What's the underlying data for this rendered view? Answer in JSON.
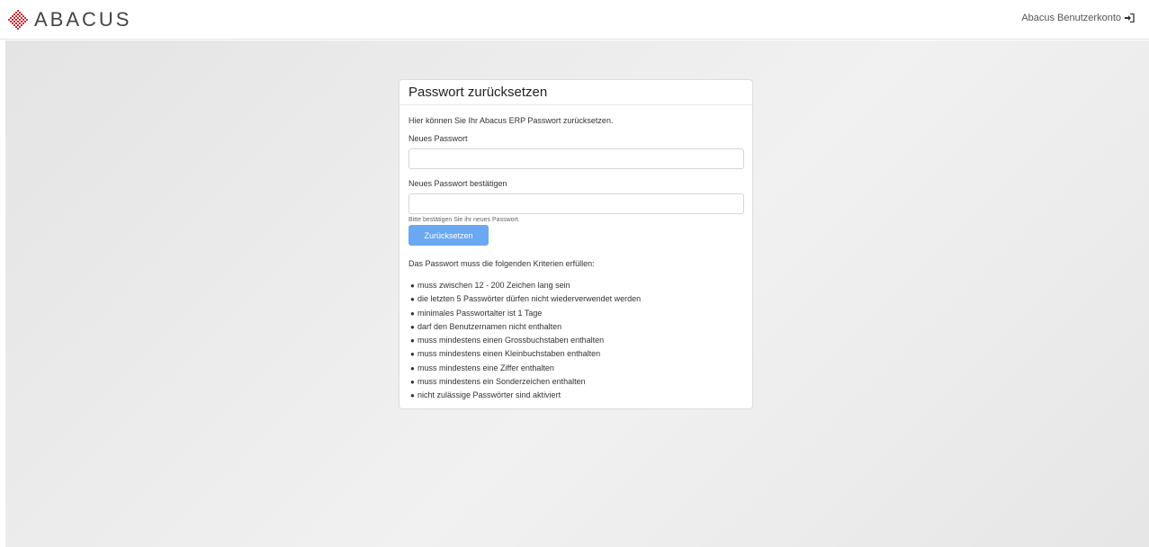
{
  "header": {
    "logo_text": "ABACUS",
    "account_link": "Abacus Benutzerkonto",
    "account_icon": "sign-in-icon"
  },
  "colors": {
    "brand_red": "#d7282f",
    "button": "#6aa9f2",
    "background": "#ebebeb"
  },
  "card": {
    "title": "Passwort zurücksetzen",
    "intro": "Hier können Sie Ihr Abacus ERP Passwort zurücksetzen.",
    "new_password_label": "Neues Passwort",
    "new_password_value": "",
    "confirm_password_label": "Neues Passwort bestätigen",
    "confirm_password_value": "",
    "confirm_hint": "Bitte bestätigen Sie ihr neues Passwort.",
    "submit_label": "Zurücksetzen",
    "criteria_title": "Das Passwort muss die folgenden Kriterien erfüllen:",
    "criteria": [
      "muss zwischen 12 - 200 Zeichen lang sein",
      "die letzten 5 Passwörter dürfen nicht wiederverwendet werden",
      "minimales Passwortalter ist 1 Tage",
      "darf den Benutzernamen nicht enthalten",
      "muss mindestens einen Grossbuchstaben enthalten",
      "muss mindestens einen Kleinbuchstaben enthalten",
      "muss mindestens eine Ziffer enthalten",
      "muss mindestens ein Sonderzeichen enthalten",
      "nicht zulässige Passwörter sind aktiviert"
    ]
  }
}
